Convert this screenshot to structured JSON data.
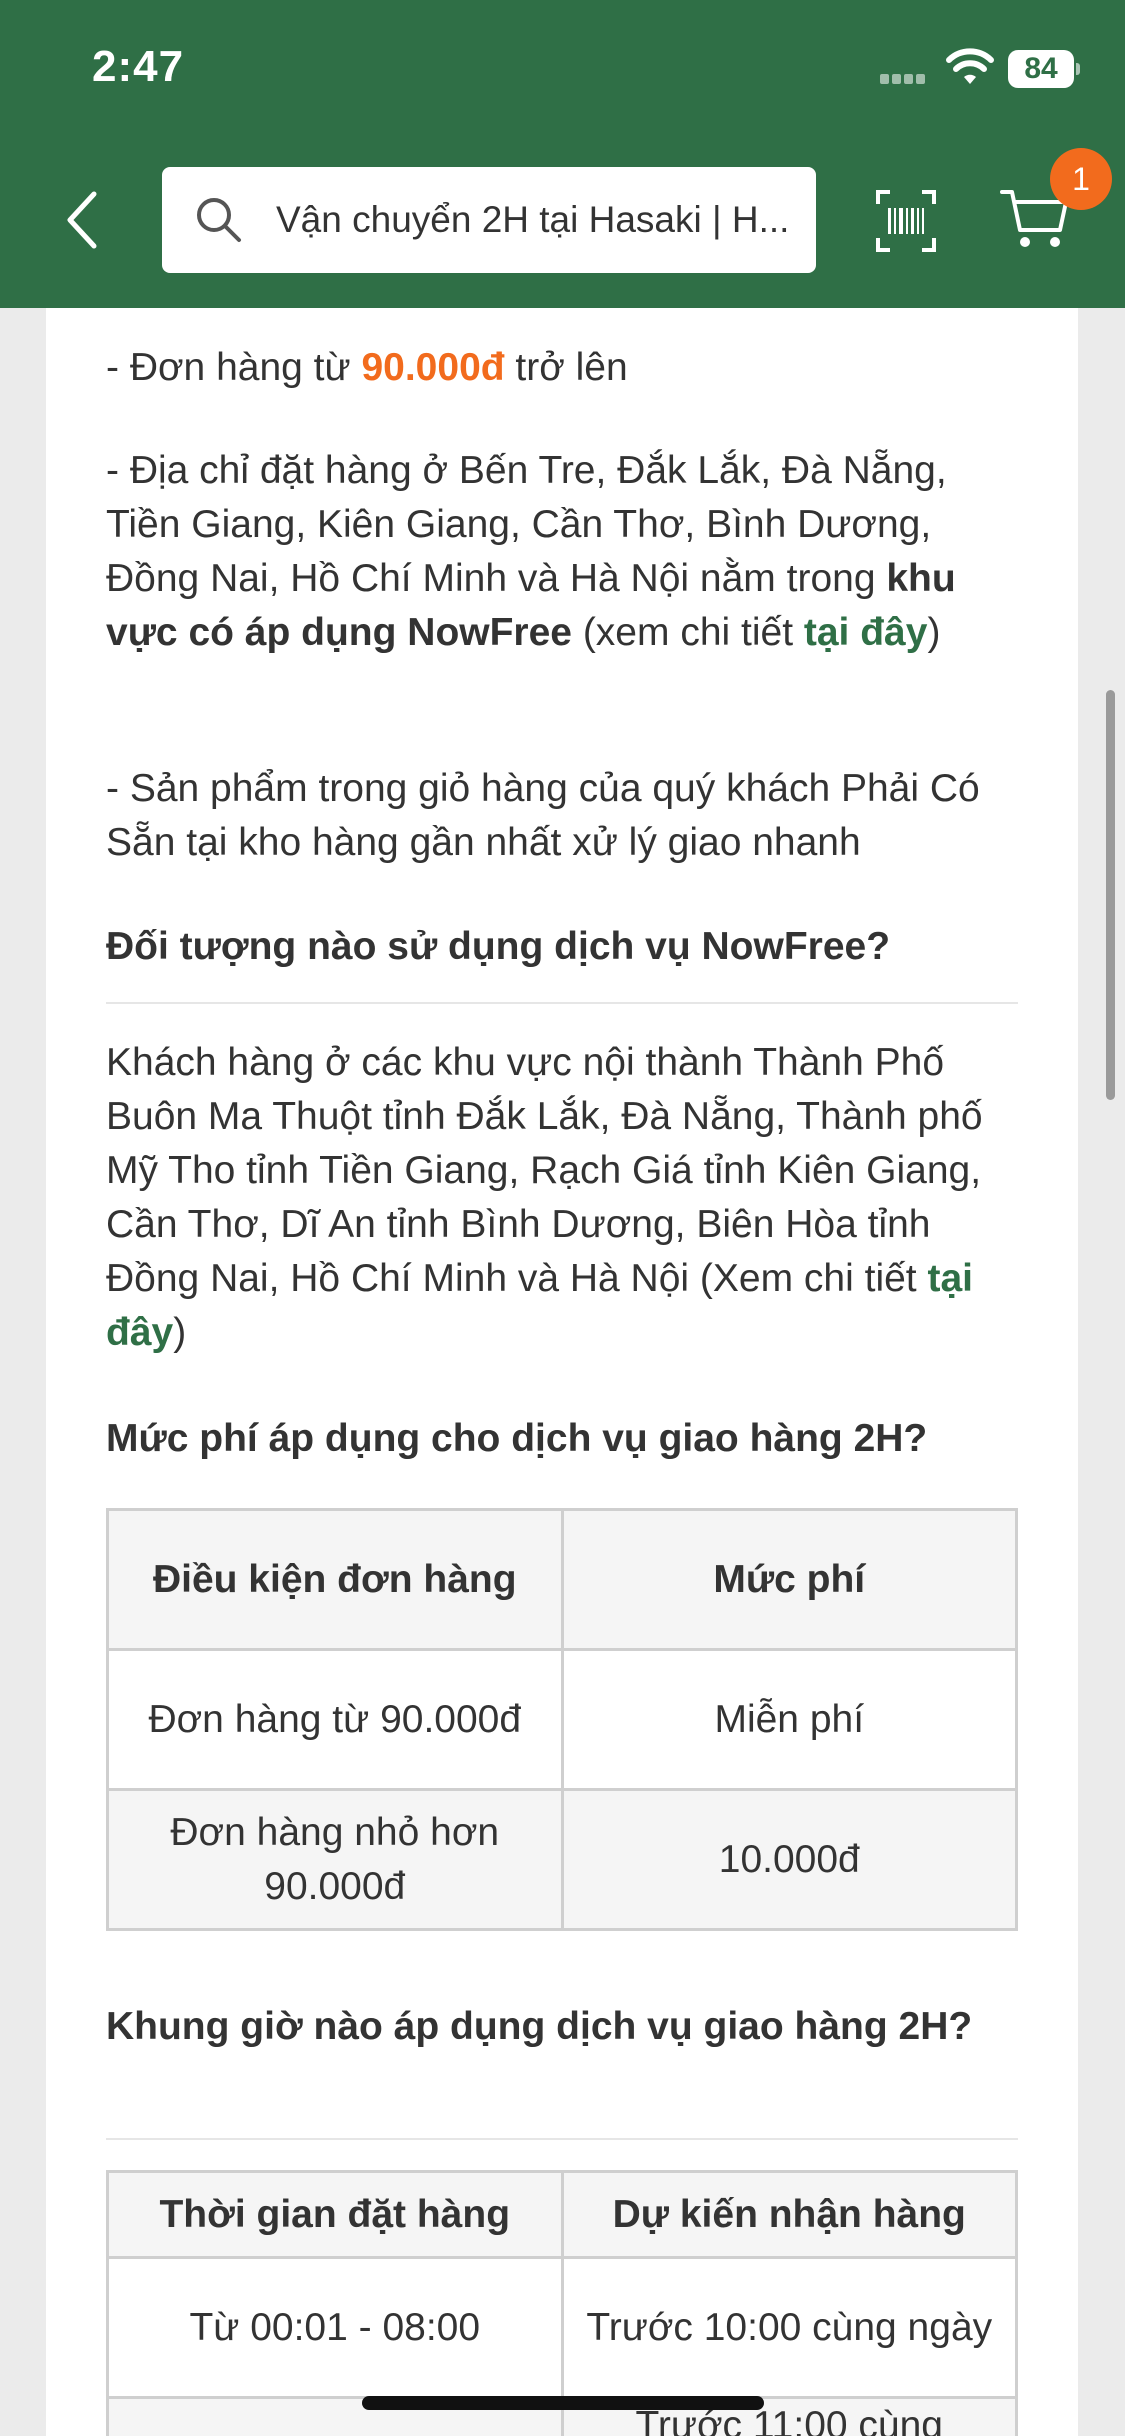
{
  "status_bar": {
    "time": "2:47",
    "battery": "84"
  },
  "header": {
    "search_text": "Vận chuyển 2H tại Hasaki | H...",
    "cart_count": "1",
    "colors": {
      "header_bg": "#2f6f46",
      "badge": "#f26b1d"
    }
  },
  "content": {
    "cond1_prefix": "- Đơn hàng từ ",
    "cond1_amount": "90.000đ",
    "cond1_suffix": " trở lên",
    "cond2_text": "- Địa chỉ đặt hàng ở Bến Tre, Đắk Lắk, Đà Nẵng, Tiền Giang, Kiên Giang, Cần Thơ, Bình Dương, Đồng Nai, Hồ Chí Minh và Hà Nội nằm trong ",
    "cond2_bold": "khu vực có áp dụng NowFree",
    "cond2_after": " (xem chi tiết ",
    "cond2_link": "tại đây",
    "cond2_close": ")",
    "cond3_text": "- Sản phẩm trong giỏ hàng của quý khách Phải Có Sẵn tại kho hàng gần nhất xử lý giao nhanh",
    "heading1": "Đối tượng nào sử dụng dịch vụ NowFree?",
    "para1_text": "Khách hàng ở các khu vực nội thành Thành Phố Buôn Ma Thuột tỉnh Đắk Lắk, Đà Nẵng, Thành phố Mỹ Tho tỉnh Tiền Giang, Rạch Giá tỉnh Kiên Giang, Cần Thơ, Dĩ An tỉnh Bình Dương, Biên Hòa tỉnh Đồng Nai, Hồ Chí Minh và Hà Nội (Xem chi tiết ",
    "para1_link": "tại đây",
    "para1_close": ")",
    "heading2": "Mức phí áp dụng cho dịch vụ giao hàng 2H?",
    "fee_table": {
      "headers": [
        "Điều kiện đơn hàng",
        "Mức phí"
      ],
      "rows": [
        [
          "Đơn hàng từ 90.000đ",
          "Miễn phí"
        ],
        [
          "Đơn hàng nhỏ hơn 90.000đ",
          "10.000đ"
        ]
      ]
    },
    "heading3": "Khung giờ nào áp dụng dịch vụ giao hàng 2H?",
    "time_table": {
      "headers": [
        "Thời gian đặt hàng",
        "Dự kiến nhận hàng"
      ],
      "rows": [
        [
          "Từ 00:01 - 08:00",
          "Trước 10:00 cùng ngày"
        ],
        [
          "",
          "Trước 11:00 cùng"
        ]
      ]
    }
  }
}
